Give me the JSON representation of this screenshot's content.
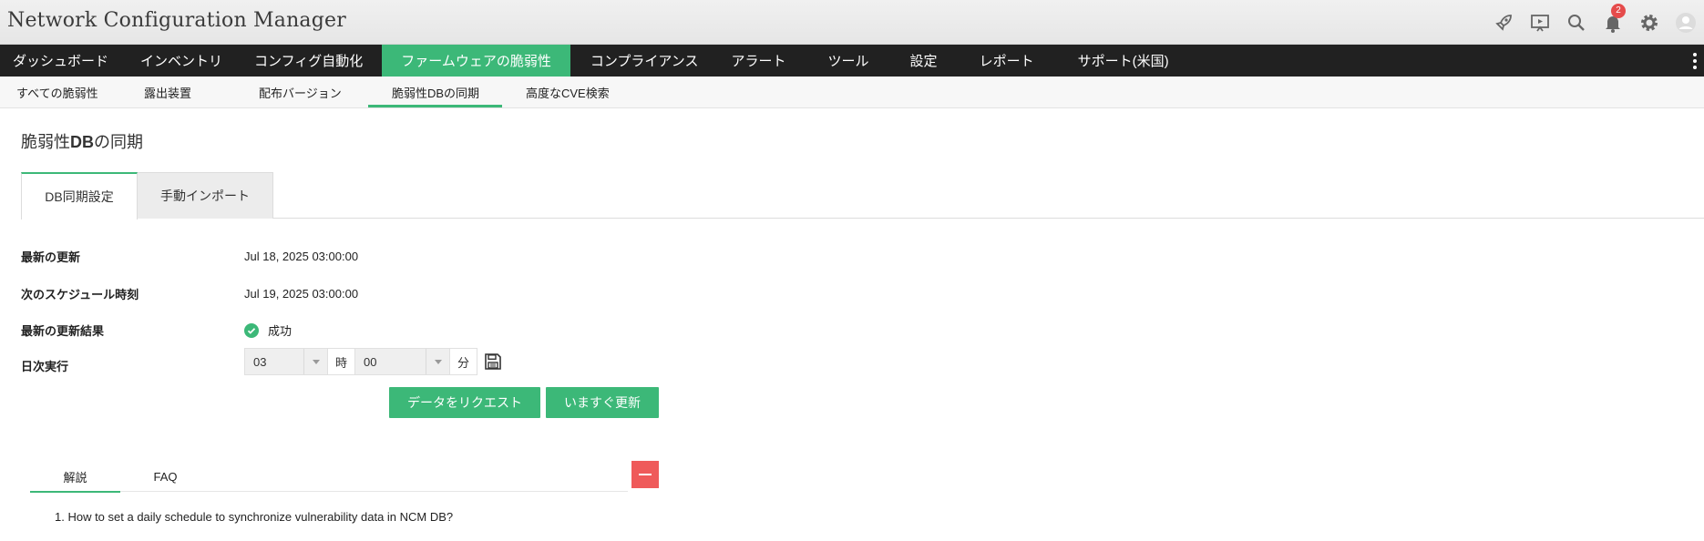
{
  "app": {
    "title": "Network Configuration Manager"
  },
  "header": {
    "icons": [
      "rocket-icon",
      "presentation-play-icon",
      "search-icon",
      "bell-icon",
      "gear-icon",
      "user-avatar-icon"
    ],
    "notification_count": "2"
  },
  "main_nav": {
    "items": [
      {
        "label": "ダッシュボード"
      },
      {
        "label": "インベントリ"
      },
      {
        "label": "コンフィグ自動化"
      },
      {
        "label": "ファームウェアの脆弱性",
        "active": true
      },
      {
        "label": "コンプライアンス"
      },
      {
        "label": "アラート"
      },
      {
        "label": "ツール"
      },
      {
        "label": "設定"
      },
      {
        "label": "レポート"
      },
      {
        "label": "サポート(米国)"
      }
    ]
  },
  "sub_nav": {
    "items": [
      {
        "label": "すべての脆弱性"
      },
      {
        "label": "露出装置"
      },
      {
        "label": "配布バージョン"
      },
      {
        "label": "脆弱性DBの同期",
        "active": true
      },
      {
        "label": "高度なCVE検索"
      }
    ]
  },
  "page": {
    "title_prefix": "脆弱性",
    "title_bold": "DB",
    "title_suffix": "の同期"
  },
  "tabs": [
    {
      "label": "DB同期設定",
      "active": true
    },
    {
      "label": "手動インポート"
    }
  ],
  "form": {
    "last_update": {
      "label": "最新の更新",
      "value": "Jul 18, 2025 03:00:00"
    },
    "next_schedule": {
      "label": "次のスケジュール時刻",
      "value": "Jul 19, 2025 03:00:00"
    },
    "last_result": {
      "label": "最新の更新結果",
      "value": "成功",
      "status_color": "#3cb878"
    },
    "daily_run": {
      "label": "日次実行",
      "hour_value": "03",
      "hour_unit": "時",
      "minute_value": "00",
      "minute_unit": "分"
    }
  },
  "buttons": {
    "request_data": "データをリクエスト",
    "update_now": "いますぐ更新"
  },
  "help": {
    "tabs": [
      {
        "label": "解説",
        "active": true
      },
      {
        "label": "FAQ"
      }
    ],
    "items": [
      "1. How to set a daily schedule to synchronize vulnerability data in NCM DB?"
    ]
  },
  "colors": {
    "accent": "#3cb878",
    "nav_bg": "#212121",
    "collapse": "#ef5a5a",
    "badge": "#e54b4b"
  }
}
